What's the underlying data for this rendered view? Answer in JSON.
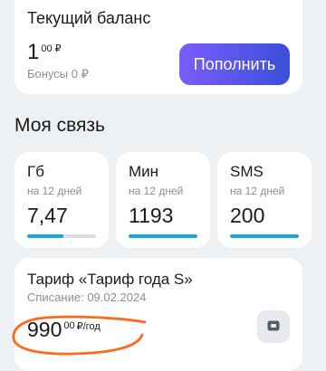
{
  "balance": {
    "title": "Текущий баланс",
    "amount_int": "1",
    "amount_frac": "00 ₽",
    "bonus": "Бонусы 0 ₽",
    "topup_label": "Пополнить"
  },
  "section_title": "Моя связь",
  "usage": [
    {
      "label": "Гб",
      "period": "на 12 дней",
      "value": "7,47",
      "fill_fraction": 0.52
    },
    {
      "label": "Мин",
      "period": "на 12 дней",
      "value": "1193",
      "fill_fraction": 1.0
    },
    {
      "label": "SMS",
      "period": "на 12 дней",
      "value": "200",
      "fill_fraction": 1.0
    }
  ],
  "tariff": {
    "name": "Тариф «Тариф года S»",
    "charge_date": "Списание: 09.02.2024",
    "price_int": "990",
    "price_frac": "00",
    "price_unit": "₽/год",
    "icon": "sim-card-icon"
  },
  "colors": {
    "accent_start": "#7b5cff",
    "accent_end": "#3a4fd8",
    "progress": "#18a6e0",
    "annotation": "#ff6a1a"
  }
}
